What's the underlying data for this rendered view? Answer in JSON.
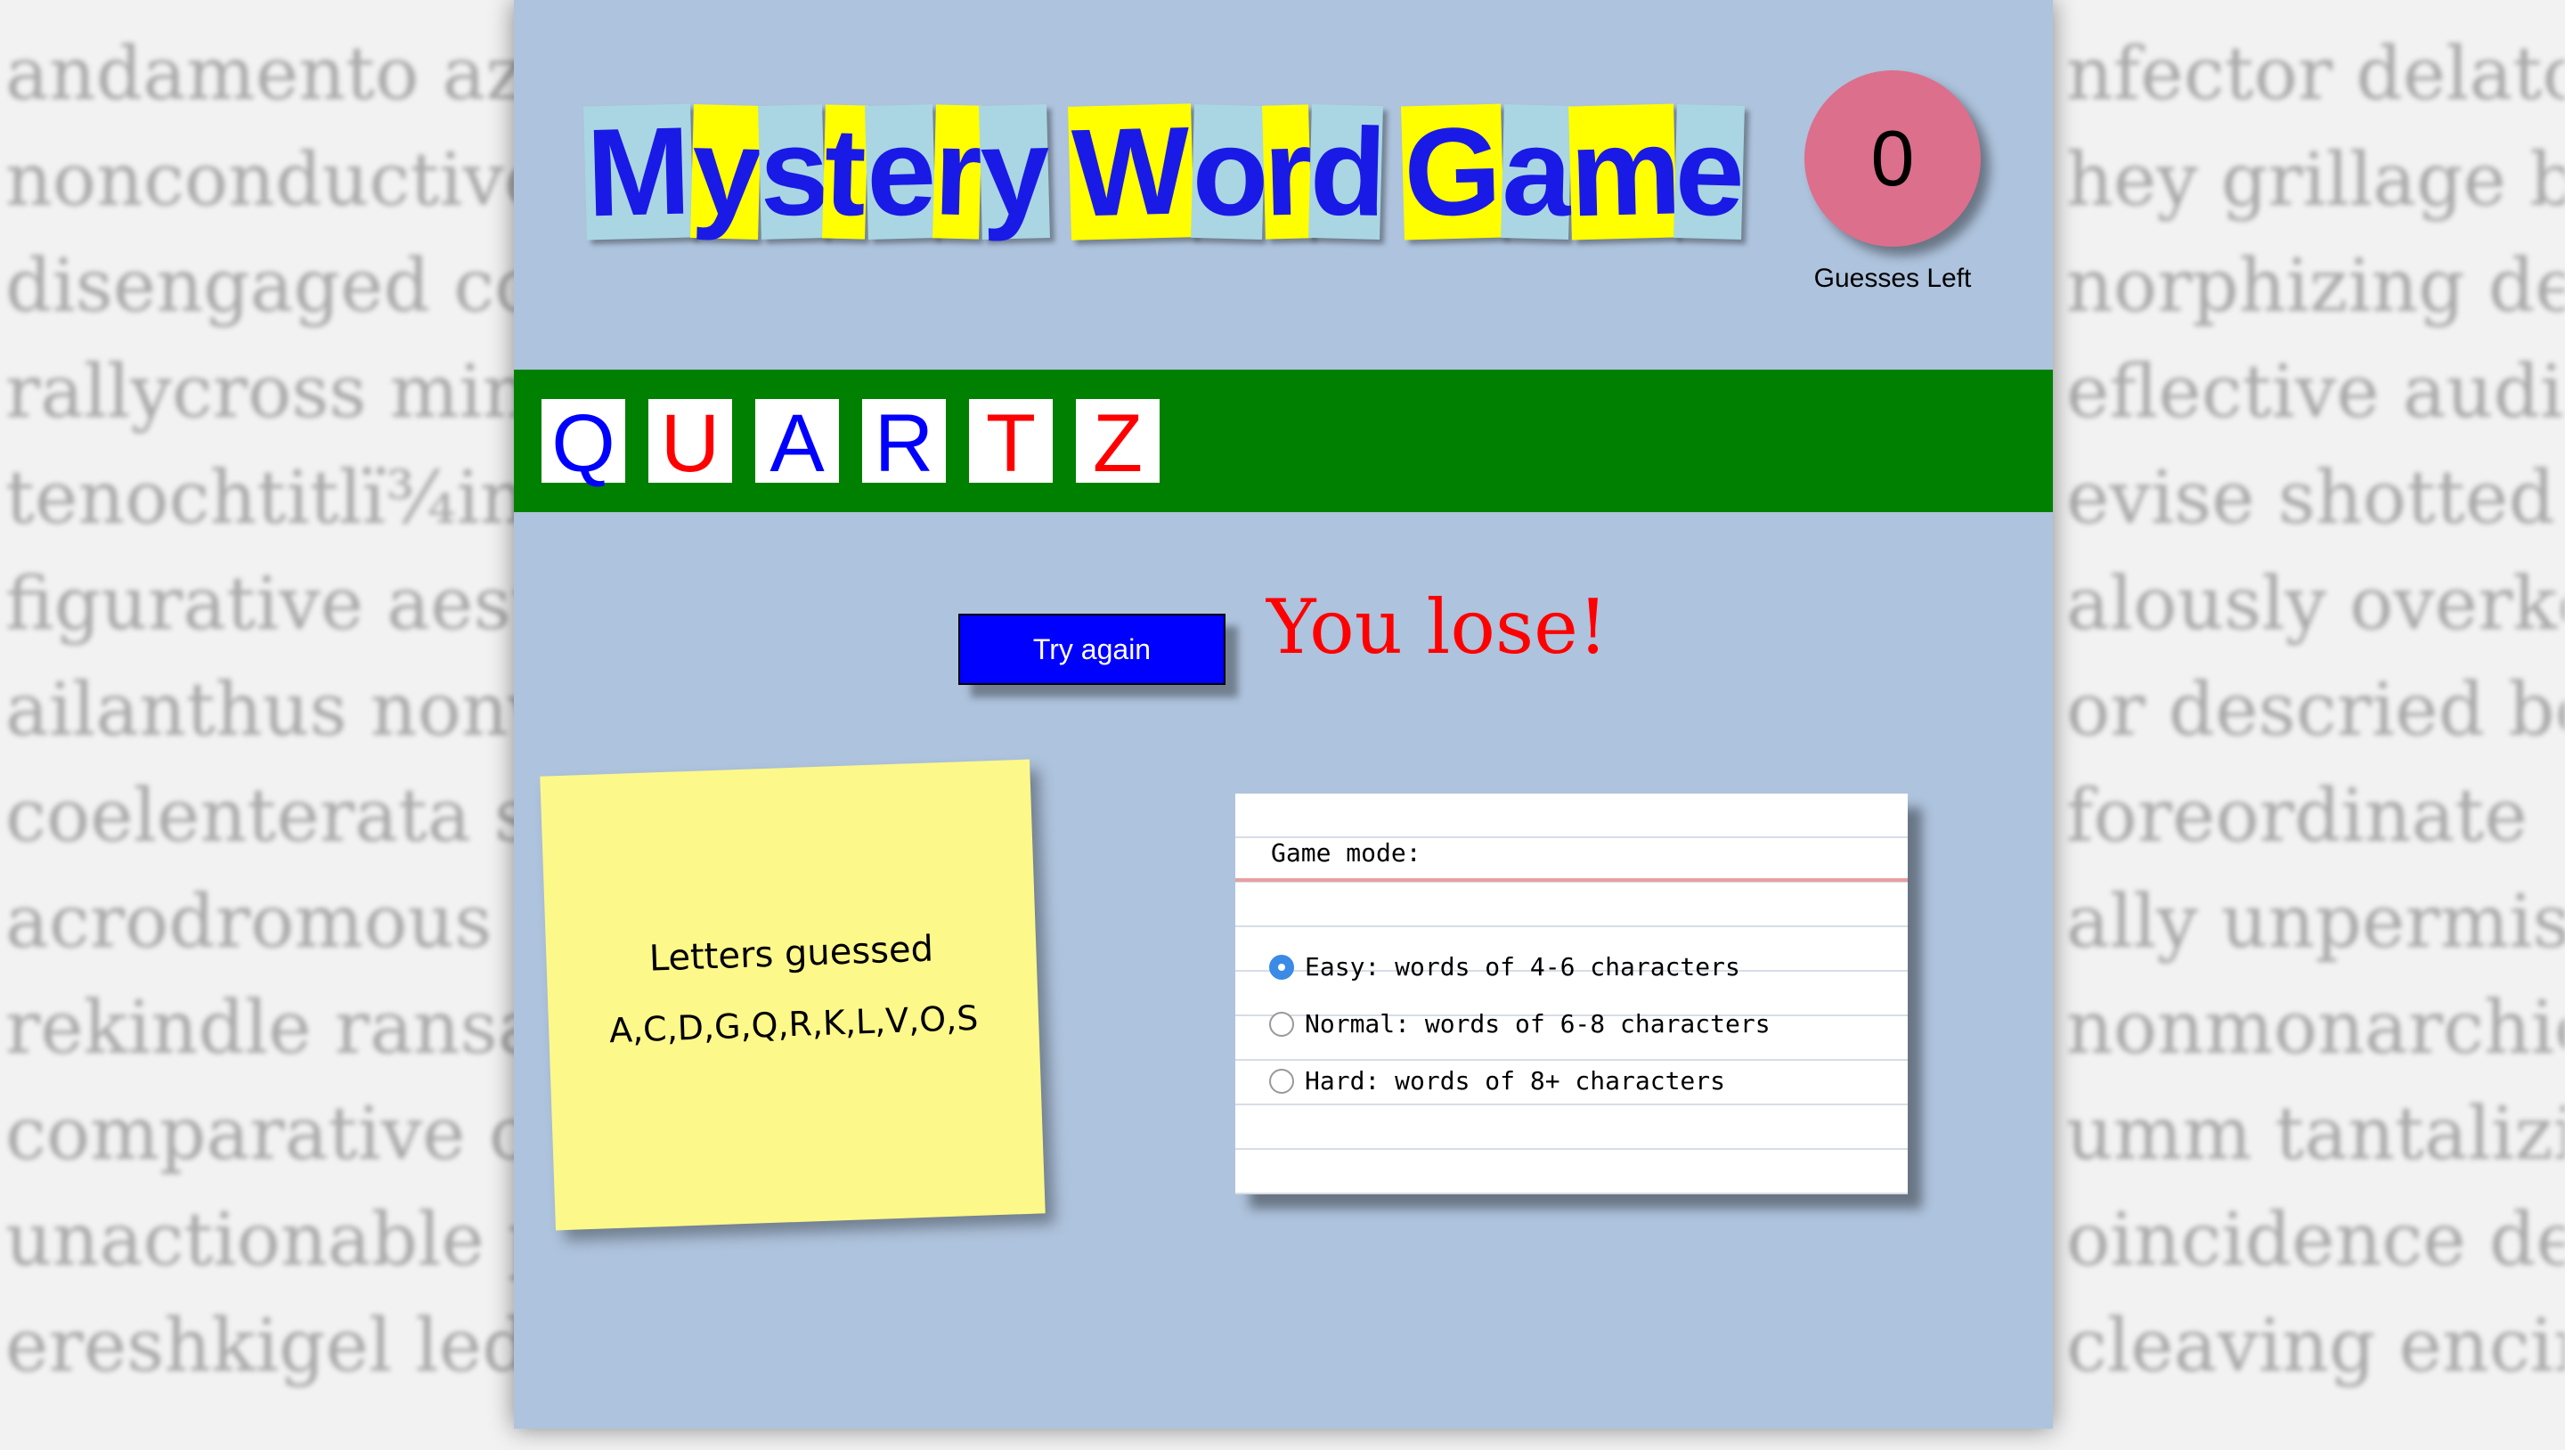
{
  "background_words": [
    [
      "andamento azo",
      "nfector delator"
    ],
    [
      "nonconductive",
      "hey grillage br"
    ],
    [
      "disengaged con",
      "norphizing den"
    ],
    [
      "rallycross minh",
      "eflective audie"
    ],
    [
      "tenochtitlï¾in",
      "evise shotted p"
    ],
    [
      "figurative aesta",
      "alously overkee"
    ],
    [
      "ailanthus nonv",
      "or descried bed"
    ],
    [
      "coelenterata su",
      "foreordinate"
    ],
    [
      "acrodromous ta",
      "ally unpermiss"
    ],
    [
      "rekindle ransac",
      "nonmonarchica"
    ],
    [
      "comparative op",
      "umm tantalizin"
    ],
    [
      "unactionable p",
      "oincidence dec"
    ],
    [
      "ereshkigel led v",
      "cleaving encin"
    ]
  ],
  "title": {
    "words": [
      "Mystery",
      "Word",
      "Game"
    ]
  },
  "guesses": {
    "count": "0",
    "label": "Guesses Left"
  },
  "word": {
    "letters": [
      {
        "char": "Q",
        "color": "#0000ff"
      },
      {
        "char": "U",
        "color": "#ff0000"
      },
      {
        "char": "A",
        "color": "#0000ff"
      },
      {
        "char": "R",
        "color": "#0000ff"
      },
      {
        "char": "T",
        "color": "#ff0000"
      },
      {
        "char": "Z",
        "color": "#ff0000"
      }
    ]
  },
  "actions": {
    "try_again": "Try again"
  },
  "result": {
    "message": "You lose!"
  },
  "sticky": {
    "title": "Letters guessed",
    "letters": "A,C,D,G,Q,R,K,L,V,O,S"
  },
  "mode": {
    "title": "Game mode:",
    "options": [
      {
        "label": "Easy: words of 4-6 characters",
        "selected": true
      },
      {
        "label": "Normal: words of 6-8 characters",
        "selected": false
      },
      {
        "label": "Hard: words of 8+ characters",
        "selected": false
      }
    ]
  },
  "colors": {
    "panel": "#aec3dd",
    "word_bar": "#008000",
    "button": "#0000ff",
    "lose_text": "#ff0000",
    "sticky": "#fdf88a",
    "counter": "#dc6f8c"
  }
}
